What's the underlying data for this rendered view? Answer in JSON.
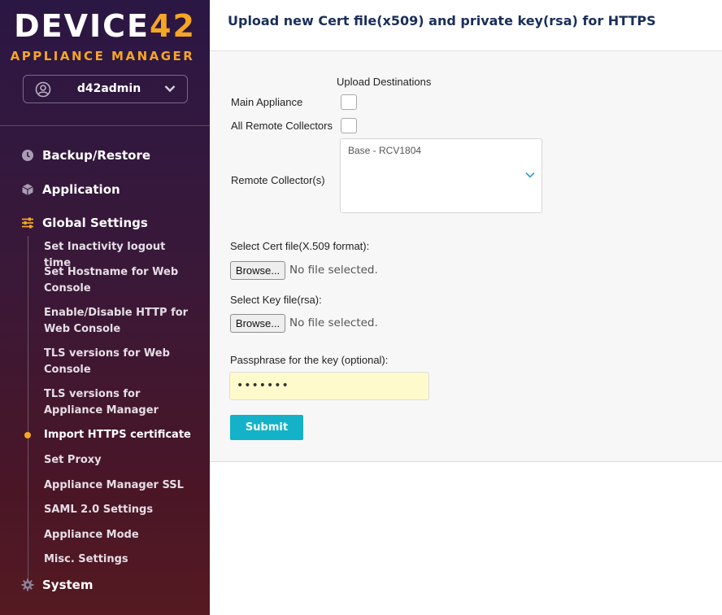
{
  "brand": {
    "logo_main": "DEVICE",
    "logo_accent": "42",
    "subtitle": "APPLIANCE MANAGER",
    "accent_color": "#f5a623"
  },
  "user": {
    "name": "d42admin",
    "avatar_icon": "user-circle-icon",
    "dropdown_icon": "chevron-down-icon"
  },
  "sidebar": {
    "sections": [
      {
        "label": "Backup/Restore",
        "icon": "clock-icon"
      },
      {
        "label": "Application",
        "icon": "cube-icon"
      },
      {
        "label": "Global Settings",
        "icon": "sliders-icon"
      },
      {
        "label": "System",
        "icon": "gear-icon"
      }
    ],
    "global_settings_items": [
      "Set Inactivity logout time",
      "Set Hostname for Web Console",
      "Enable/Disable HTTP for Web Console",
      "TLS versions for Web Console",
      "TLS versions for Appliance Manager",
      "Import HTTPS certificate",
      "Set Proxy",
      "Appliance Manager SSL",
      "SAML 2.0 Settings",
      "Appliance Mode",
      "Misc. Settings"
    ],
    "active_item": "Import HTTPS certificate"
  },
  "page": {
    "title": "Upload new Cert file(x509) and private key(rsa) for HTTPS"
  },
  "form": {
    "destinations_heading": "Upload Destinations",
    "main_appliance_label": "Main Appliance",
    "all_remote_collectors_label": "All Remote Collectors",
    "remote_collectors_label": "Remote Collector(s)",
    "remote_collector_option": "Base - RCV1804",
    "cert_file_label": "Select Cert file(X.509 format):",
    "key_file_label": "Select Key file(rsa):",
    "browse_label": "Browse...",
    "no_file_text": "No file selected.",
    "passphrase_label": "Passphrase for the key (optional):",
    "passphrase_value": "•••••••",
    "submit_label": "Submit",
    "submit_color": "#14b2c8"
  }
}
